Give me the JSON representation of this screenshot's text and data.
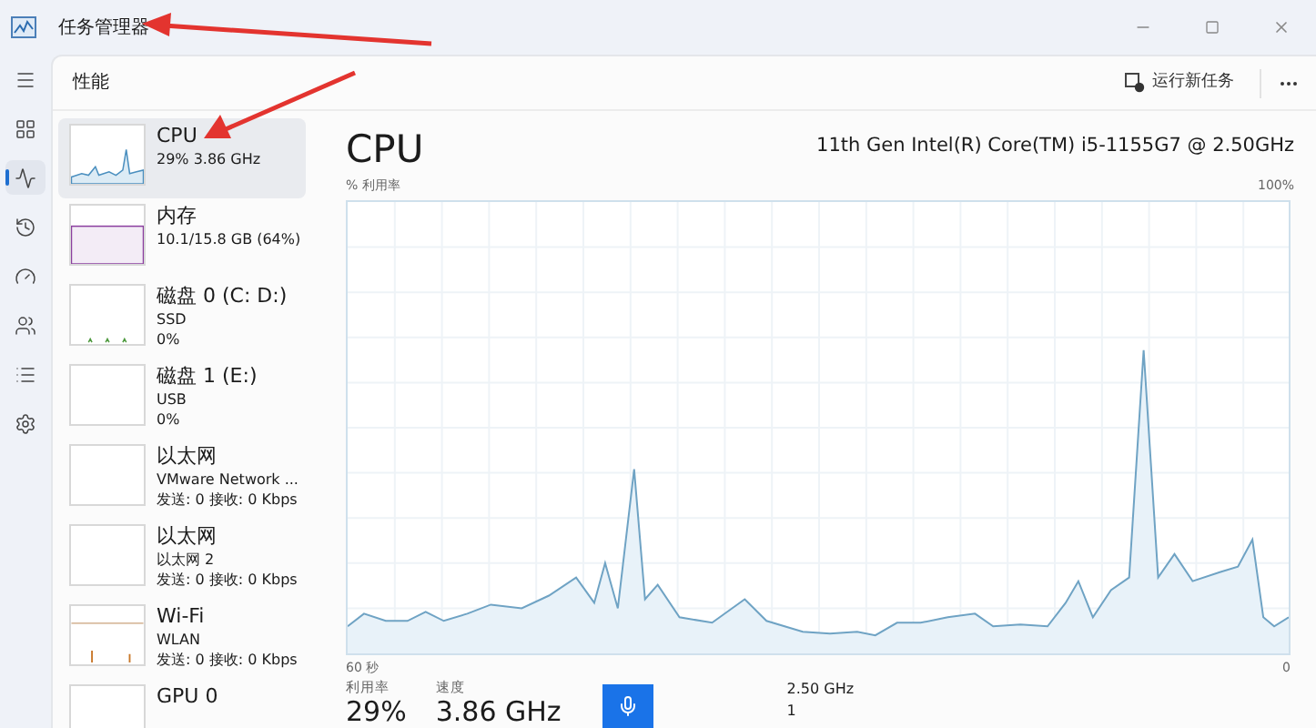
{
  "window": {
    "title": "任务管理器"
  },
  "nav_items": [
    {
      "kind": "menu",
      "selected": false
    },
    {
      "kind": "processes",
      "selected": false
    },
    {
      "kind": "performance",
      "selected": true
    },
    {
      "kind": "history",
      "selected": false
    },
    {
      "kind": "startup",
      "selected": false
    },
    {
      "kind": "users",
      "selected": false
    },
    {
      "kind": "details",
      "selected": false
    },
    {
      "kind": "services",
      "selected": false
    }
  ],
  "page": {
    "title": "性能",
    "run_task": "运行新任务"
  },
  "resources": [
    {
      "kind": "cpu",
      "name": "CPU",
      "lines": [
        "29% 3.86 GHz"
      ],
      "selected": true
    },
    {
      "kind": "memory",
      "name": "内存",
      "lines": [
        "10.1/15.8 GB (64%)"
      ],
      "selected": false
    },
    {
      "kind": "disk",
      "name": "磁盘 0 (C: D:)",
      "lines": [
        "SSD",
        "0%"
      ],
      "selected": false
    },
    {
      "kind": "idle",
      "name": "磁盘 1 (E:)",
      "lines": [
        "USB",
        "0%"
      ],
      "selected": false
    },
    {
      "kind": "idle",
      "name": "以太网",
      "lines": [
        "VMware Network ...",
        "发送: 0 接收: 0 Kbps"
      ],
      "selected": false
    },
    {
      "kind": "idle",
      "name": "以太网",
      "lines": [
        "以太网 2",
        "发送: 0 接收: 0 Kbps"
      ],
      "selected": false
    },
    {
      "kind": "wifi",
      "name": "Wi-Fi",
      "lines": [
        "WLAN",
        "发送: 0 接收: 0 Kbps"
      ],
      "selected": false
    },
    {
      "kind": "idle",
      "name": "GPU 0",
      "selected": false
    }
  ],
  "detail": {
    "title": "CPU",
    "processor": "11th Gen Intel(R) Core(TM) i5-1155G7 @ 2.50GHz",
    "axis_label": "% 利用率",
    "axis_max": "100%",
    "time_start": "60 秒",
    "time_end": "0",
    "stats": [
      {
        "label": "利用率",
        "value": "29%"
      },
      {
        "label": "速度",
        "value": "3.86 GHz"
      }
    ],
    "base_speed": "2.50 GHz",
    "sockets": "1"
  }
}
